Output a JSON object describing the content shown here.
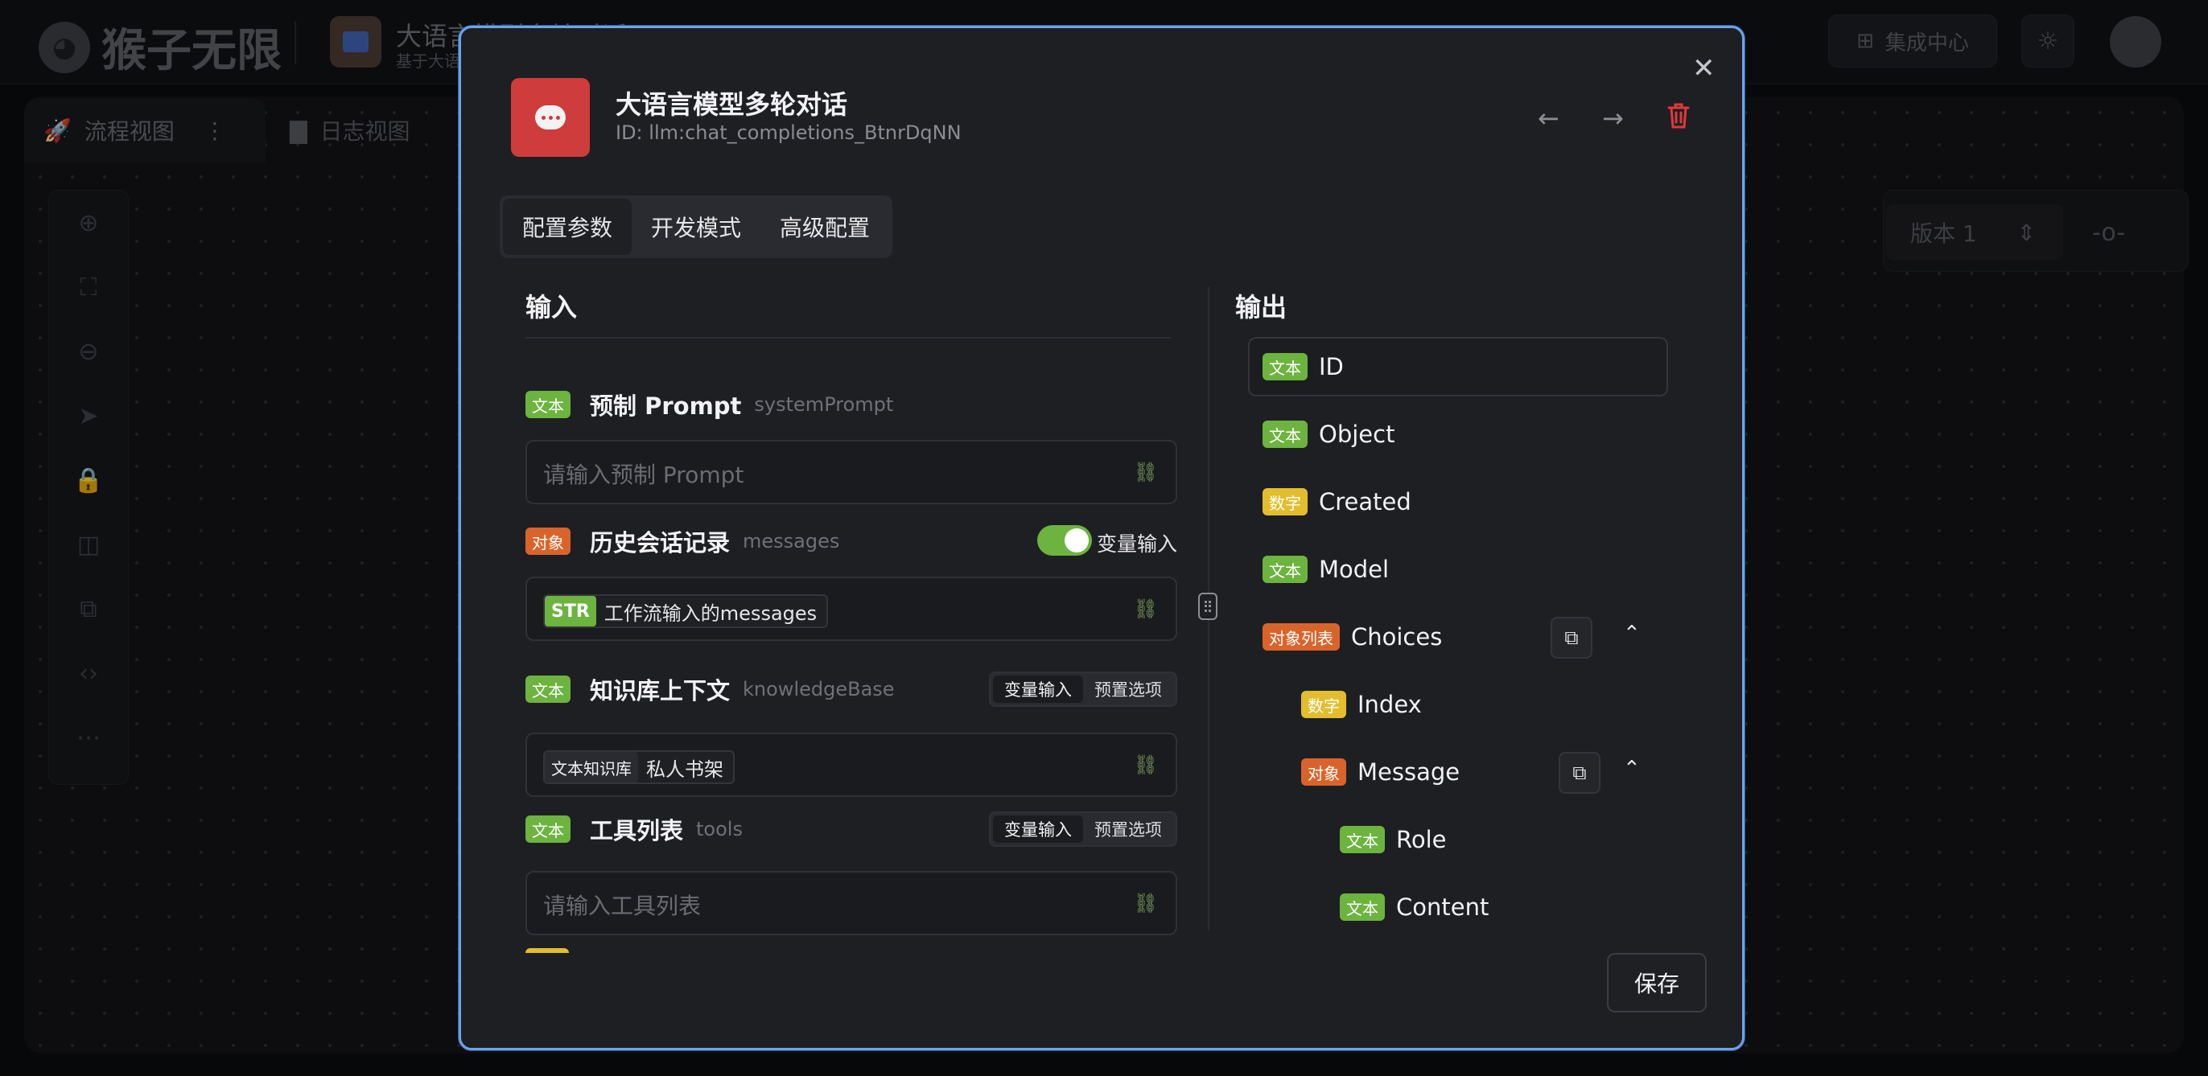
{
  "app": {
    "logo_text": "猴子无限",
    "title": "大语言模型多轮对话",
    "subtitle": "基于大语",
    "integration_label": "集成中心"
  },
  "view_tabs": {
    "flow": "流程视图",
    "log": "日志视图"
  },
  "version": {
    "label": "版本 1"
  },
  "modal": {
    "title": "大语言模型多轮对话",
    "id_text": "ID: llm:chat_completions_BtnrDqNN",
    "tabs": [
      "配置参数",
      "开发模式",
      "高级配置"
    ],
    "input_title": "输入",
    "output_title": "输出",
    "save_label": "保存"
  },
  "inputs": [
    {
      "type": "文本",
      "label": "预制 Prompt",
      "key": "systemPrompt",
      "placeholder": "请输入预制 Prompt"
    },
    {
      "type": "对象",
      "label": "历史会话记录",
      "key": "messages",
      "toggle_label": "变量输入",
      "chip_key": "STR",
      "chip_value": "工作流输入的messages"
    },
    {
      "type": "文本",
      "label": "知识库上下文",
      "key": "knowledgeBase",
      "seg": [
        "变量输入",
        "预置选项"
      ],
      "chip_key": "文本知识库",
      "chip_value": "私人书架"
    },
    {
      "type": "文本",
      "label": "工具列表",
      "key": "tools",
      "seg": [
        "变量输入",
        "预置选项"
      ],
      "placeholder": "请输入工具列表"
    }
  ],
  "outputs": [
    {
      "type": "文本",
      "name": "ID"
    },
    {
      "type": "文本",
      "name": "Object"
    },
    {
      "type": "数字",
      "name": "Created"
    },
    {
      "type": "文本",
      "name": "Model"
    },
    {
      "type": "对象列表",
      "name": "Choices"
    },
    {
      "type": "数字",
      "name": "Index"
    },
    {
      "type": "对象",
      "name": "Message"
    },
    {
      "type": "文本",
      "name": "Role"
    },
    {
      "type": "文本",
      "name": "Content"
    }
  ],
  "colors": {
    "accent_border": "#6ea3e6",
    "text_tag": "#6cb43f",
    "object_tag": "#d9642b",
    "number_tag": "#e2be2e",
    "danger": "#e0383b"
  },
  "icons": [
    "close-icon",
    "arrow-left-icon",
    "arrow-right-icon",
    "trash-icon",
    "link-icon",
    "copy-icon",
    "chevron-up-icon",
    "chat-bubble-icon"
  ]
}
